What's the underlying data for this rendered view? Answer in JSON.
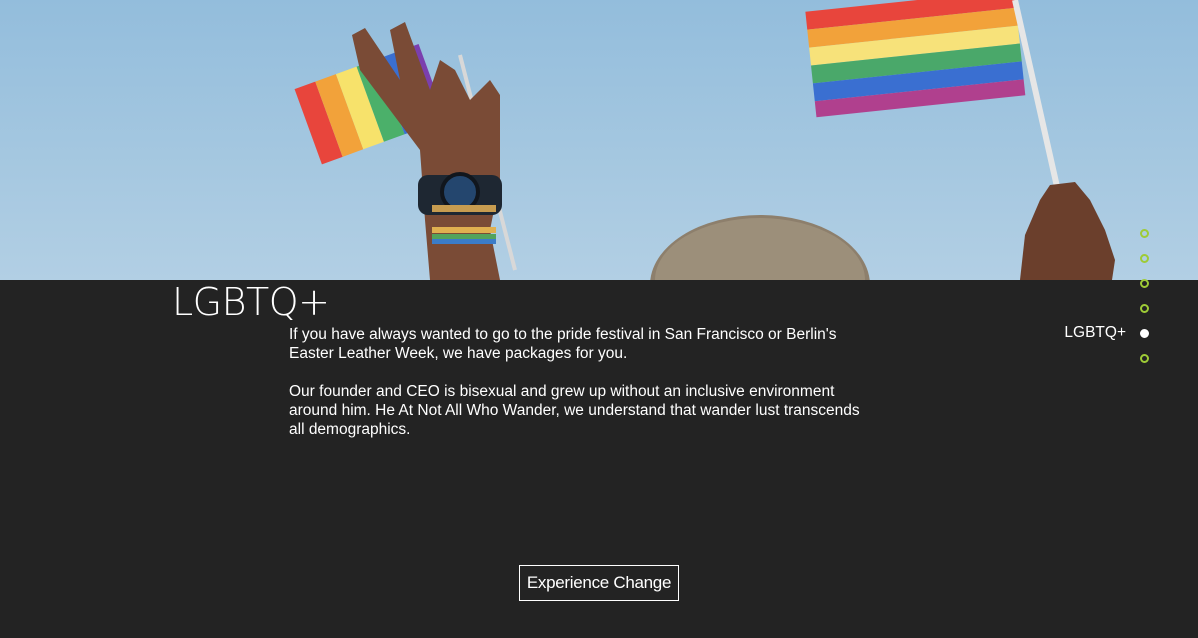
{
  "hero": {
    "image_label": "pride-flags-hero-image",
    "sky_color": "#9fc4df"
  },
  "section": {
    "title": "LGBTQ+",
    "paragraphs": [
      "If you have always wanted to go to the pride festival in San Francisco or Berlin's Easter Leather Week, we have packages for you.",
      "Our founder and CEO is bisexual and grew up without an inclusive environment around him. He At Not All Who Wander, we understand that wander lust transcends all demographics."
    ],
    "cta_label": "Experience Change"
  },
  "nav_dots": {
    "active_label": "LGBTQ+",
    "count": 6,
    "active_index": 4,
    "accent_color": "#9ecb36"
  },
  "colors": {
    "background": "#232323",
    "text": "#ffffff",
    "accent": "#9ecb36"
  }
}
